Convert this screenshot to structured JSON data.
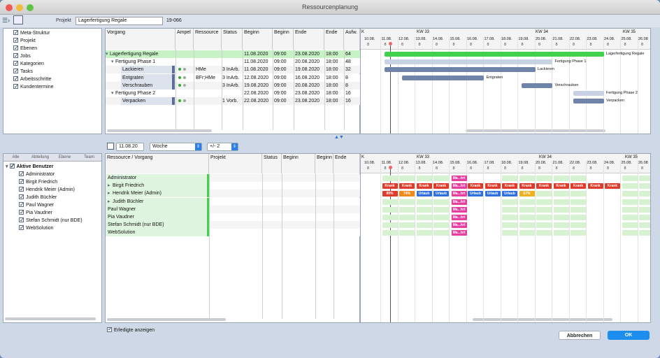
{
  "window": {
    "title": "Ressourcenplanung"
  },
  "toolbar": {
    "projekt_label": "Projekt",
    "projekt_value": "Lagerfertigung Regale",
    "projekt_number": "19-066"
  },
  "left_tree": [
    "Meta-Struktur",
    "Projekt",
    "Ebenen",
    "Jobs",
    "Kategorien",
    "Tasks",
    "Arbeitsschritte",
    "Kundentermine"
  ],
  "top_columns": {
    "vorgang": "Vorgang",
    "ampel": "Ampel",
    "ressource": "Ressource",
    "status": "Status",
    "beginn": "Beginn",
    "beginn2": "Beginn",
    "ende": "Ende",
    "ende2": "Ende",
    "aufw": "Aufw."
  },
  "top_rows": [
    {
      "name": "Lagerfertigung Regale",
      "ressource": "",
      "status": "",
      "beginn": "11.08.2020",
      "bzeit": "09:00",
      "ende": "23.08.2020",
      "ezeit": "18:00",
      "aufw": "64"
    },
    {
      "name": "Fertigung Phase 1",
      "ressource": "",
      "status": "",
      "beginn": "11.08.2020",
      "bzeit": "09:00",
      "ende": "20.08.2020",
      "ezeit": "18:00",
      "aufw": "48"
    },
    {
      "name": "Lackieren",
      "ressource": "HMe",
      "status": "3 InArb.",
      "beginn": "11.08.2020",
      "bzeit": "09:00",
      "ende": "19.08.2020",
      "ezeit": "18:00",
      "aufw": "32"
    },
    {
      "name": "Entgraten",
      "ressource": "BFr;HMe",
      "status": "3 InArb.",
      "beginn": "12.08.2020",
      "bzeit": "09:00",
      "ende": "16.08.2020",
      "ezeit": "18:00",
      "aufw": "8"
    },
    {
      "name": "Verschrauben",
      "ressource": "",
      "status": "3 InArb.",
      "beginn": "19.08.2020",
      "bzeit": "09:00",
      "ende": "20.08.2020",
      "ezeit": "18:00",
      "aufw": "8"
    },
    {
      "name": "Fertigung Phase 2",
      "ressource": "",
      "status": "",
      "beginn": "22.08.2020",
      "bzeit": "09:00",
      "ende": "23.08.2020",
      "ezeit": "18:00",
      "aufw": "16"
    },
    {
      "name": "Verpacken",
      "ressource": "",
      "status": "1 Vorb.",
      "beginn": "22.08.2020",
      "bzeit": "09:00",
      "ende": "23.08.2020",
      "ezeit": "18:00",
      "aufw": "16"
    }
  ],
  "gantt": {
    "k": "K",
    "kw33": "KW 33",
    "kw34": "KW 34",
    "kw35": "KW 35",
    "dates": [
      "10.08.",
      "11.08.",
      "12.08.",
      "13.08.",
      "14.08.",
      "15.08.",
      "16.08.",
      "17.08.",
      "18.08.",
      "19.08.",
      "20.08.",
      "21.08.",
      "22.08.",
      "23.08.",
      "24.08.",
      "25.08.",
      "26.08"
    ],
    "hour": "8",
    "bars": [
      "Lagerfertigung Regale",
      "Fertigung Phase 1",
      "Lackieren",
      "Entgraten",
      "Verschrauben",
      "Fertigung Phase 2",
      "Verpacken"
    ]
  },
  "controls": {
    "date": "11.08.20",
    "view": "Woche",
    "range": "+/- 2"
  },
  "left_tabs": [
    "Alle",
    "Abteilung",
    "Ebene",
    "Team"
  ],
  "users_root": "Aktive Benutzer",
  "users": [
    "Administrator",
    "Birgit Friedrich",
    "Hendrik Meier (Admin)",
    "Judith Büchler",
    "Paul Wagner",
    "Pia Vaudner",
    "Stefan Schmidt (nur BDE)",
    "WebSolution"
  ],
  "bottom_columns": {
    "ressource": "Ressource / Vorgang",
    "projekt": "Projekt",
    "status": "Status",
    "beginn": "Beginn",
    "beginn2": "Beginn",
    "ende": "Ende"
  },
  "bottom_gantt": {
    "dates": [
      "10.08.",
      "11.08.",
      "12.08.",
      "13.08.",
      "14.08.",
      "15.08.",
      "16.08.",
      "17.08.",
      "18.08.",
      "19.08.",
      "20.08.",
      "21.08.",
      "22.08.",
      "23.08.",
      "24.08.",
      "25.08.",
      "26.08"
    ],
    "krank": "Krank",
    "urlaub": "Urlaub",
    "ma": "Ma...hrt",
    "p1": "89%",
    "p2": "74%",
    "p3": "67%"
  },
  "footer": {
    "erledigte": "Erledigte anzeigen",
    "cancel": "Abbrechen",
    "ok": "OK"
  },
  "colors": {
    "green_bar": "#3fd24a",
    "blue_bar": "#6f84a8",
    "light_bar": "#c8d2e4",
    "krank": "#e03a2a",
    "urlaub": "#2f6fe0",
    "ma": "#e63fa0",
    "ok": "#1c8ef0"
  }
}
